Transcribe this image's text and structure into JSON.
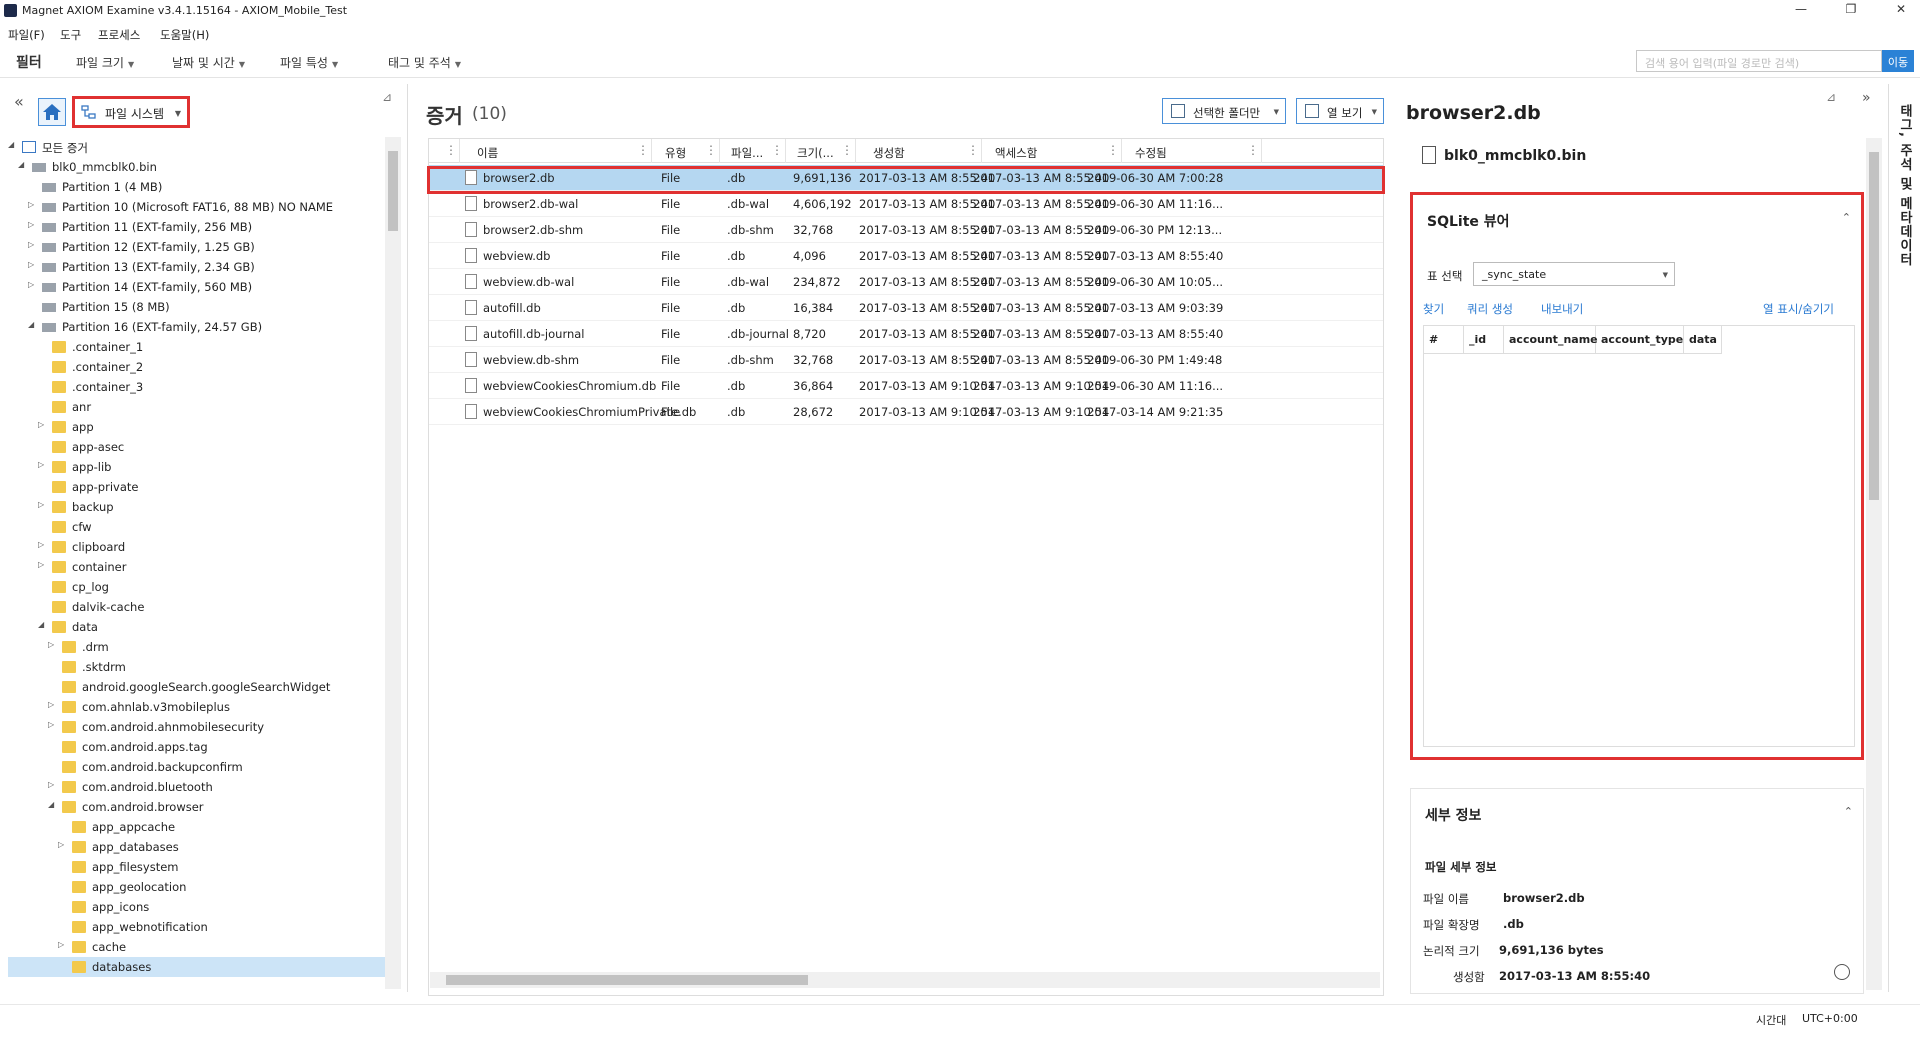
{
  "window": {
    "title": "Magnet AXIOM Examine v3.4.1.15164 - AXIOM_Mobile_Test",
    "minimize": "—",
    "maximize": "❐",
    "close": "✕"
  },
  "menu": [
    "파일(F)",
    "도구",
    "프로세스",
    "도움말(H)"
  ],
  "filterbar": {
    "label": "필터",
    "items": [
      "파일 크기",
      "날짜 및 시간",
      "파일 특성",
      "태그 및 주석"
    ],
    "search_placeholder": "검색 용어 입력(파일 경로만 검색)",
    "search_button": "이동"
  },
  "left": {
    "dropdown_label": "파일 시스템",
    "tree": [
      {
        "label": "모든 증거",
        "level": 0,
        "expand": "◢",
        "icon": "root"
      },
      {
        "label": "blk0_mmcblk0.bin",
        "level": 1,
        "expand": "◢",
        "icon": "drive"
      },
      {
        "label": "Partition 1 (4 MB)",
        "level": 2,
        "expand": "",
        "icon": "drive"
      },
      {
        "label": "Partition 10 (Microsoft FAT16, 88 MB) NO NAME",
        "level": 2,
        "expand": "▷",
        "icon": "drive"
      },
      {
        "label": "Partition 11 (EXT-family, 256 MB)",
        "level": 2,
        "expand": "▷",
        "icon": "drive"
      },
      {
        "label": "Partition 12 (EXT-family, 1.25 GB)",
        "level": 2,
        "expand": "▷",
        "icon": "drive"
      },
      {
        "label": "Partition 13 (EXT-family, 2.34 GB)",
        "level": 2,
        "expand": "▷",
        "icon": "drive"
      },
      {
        "label": "Partition 14 (EXT-family, 560 MB)",
        "level": 2,
        "expand": "▷",
        "icon": "drive"
      },
      {
        "label": "Partition 15 (8 MB)",
        "level": 2,
        "expand": "",
        "icon": "drive"
      },
      {
        "label": "Partition 16 (EXT-family, 24.57 GB)",
        "level": 2,
        "expand": "◢",
        "icon": "drive"
      },
      {
        "label": ".container_1",
        "level": 3,
        "expand": "",
        "icon": "folder"
      },
      {
        "label": ".container_2",
        "level": 3,
        "expand": "",
        "icon": "folder"
      },
      {
        "label": ".container_3",
        "level": 3,
        "expand": "",
        "icon": "folder"
      },
      {
        "label": "anr",
        "level": 3,
        "expand": "",
        "icon": "folder"
      },
      {
        "label": "app",
        "level": 3,
        "expand": "▷",
        "icon": "folder"
      },
      {
        "label": "app-asec",
        "level": 3,
        "expand": "",
        "icon": "folder"
      },
      {
        "label": "app-lib",
        "level": 3,
        "expand": "▷",
        "icon": "folder"
      },
      {
        "label": "app-private",
        "level": 3,
        "expand": "",
        "icon": "folder"
      },
      {
        "label": "backup",
        "level": 3,
        "expand": "▷",
        "icon": "folder"
      },
      {
        "label": "cfw",
        "level": 3,
        "expand": "",
        "icon": "folder"
      },
      {
        "label": "clipboard",
        "level": 3,
        "expand": "▷",
        "icon": "folder"
      },
      {
        "label": "container",
        "level": 3,
        "expand": "▷",
        "icon": "folder"
      },
      {
        "label": "cp_log",
        "level": 3,
        "expand": "",
        "icon": "folder"
      },
      {
        "label": "dalvik-cache",
        "level": 3,
        "expand": "",
        "icon": "folder"
      },
      {
        "label": "data",
        "level": 3,
        "expand": "◢",
        "icon": "folder"
      },
      {
        "label": ".drm",
        "level": 4,
        "expand": "▷",
        "icon": "folder"
      },
      {
        "label": ".sktdrm",
        "level": 4,
        "expand": "",
        "icon": "folder"
      },
      {
        "label": "android.googleSearch.googleSearchWidget",
        "level": 4,
        "expand": "",
        "icon": "folder"
      },
      {
        "label": "com.ahnlab.v3mobileplus",
        "level": 4,
        "expand": "▷",
        "icon": "folder"
      },
      {
        "label": "com.android.ahnmobilesecurity",
        "level": 4,
        "expand": "▷",
        "icon": "folder"
      },
      {
        "label": "com.android.apps.tag",
        "level": 4,
        "expand": "",
        "icon": "folder"
      },
      {
        "label": "com.android.backupconfirm",
        "level": 4,
        "expand": "",
        "icon": "folder"
      },
      {
        "label": "com.android.bluetooth",
        "level": 4,
        "expand": "▷",
        "icon": "folder"
      },
      {
        "label": "com.android.browser",
        "level": 4,
        "expand": "◢",
        "icon": "folder"
      },
      {
        "label": "app_appcache",
        "level": 5,
        "expand": "",
        "icon": "folder"
      },
      {
        "label": "app_databases",
        "level": 5,
        "expand": "▷",
        "icon": "folder"
      },
      {
        "label": "app_filesystem",
        "level": 5,
        "expand": "",
        "icon": "folder"
      },
      {
        "label": "app_geolocation",
        "level": 5,
        "expand": "",
        "icon": "folder"
      },
      {
        "label": "app_icons",
        "level": 5,
        "expand": "",
        "icon": "folder"
      },
      {
        "label": "app_webnotification",
        "level": 5,
        "expand": "",
        "icon": "folder"
      },
      {
        "label": "cache",
        "level": 5,
        "expand": "▷",
        "icon": "folder"
      },
      {
        "label": "databases",
        "level": 5,
        "expand": "",
        "icon": "folder",
        "selected": true
      }
    ]
  },
  "center": {
    "title": "증거",
    "count": "(10)",
    "folder_button": "선택한 폴더만",
    "view_button": "열 보기",
    "columns": [
      "이름",
      "유형",
      "파일...",
      "크기(...",
      "생성함",
      "액세스함",
      "수정됨"
    ],
    "rows": [
      {
        "name": "browser2.db",
        "type": "File",
        "ext": ".db",
        "size": "9,691,136",
        "created": "2017-03-13 AM 8:55:40",
        "accessed": "2017-03-13 AM 8:55:40",
        "modified": "2019-06-30 AM 7:00:28",
        "selected": true
      },
      {
        "name": "browser2.db-wal",
        "type": "File",
        "ext": ".db-wal",
        "size": "4,606,192",
        "created": "2017-03-13 AM 8:55:40",
        "accessed": "2017-03-13 AM 8:55:40",
        "modified": "2019-06-30 AM 11:16..."
      },
      {
        "name": "browser2.db-shm",
        "type": "File",
        "ext": ".db-shm",
        "size": "32,768",
        "created": "2017-03-13 AM 8:55:40",
        "accessed": "2017-03-13 AM 8:55:40",
        "modified": "2019-06-30 PM 12:13..."
      },
      {
        "name": "webview.db",
        "type": "File",
        "ext": ".db",
        "size": "4,096",
        "created": "2017-03-13 AM 8:55:40",
        "accessed": "2017-03-13 AM 8:55:40",
        "modified": "2017-03-13 AM 8:55:40"
      },
      {
        "name": "webview.db-wal",
        "type": "File",
        "ext": ".db-wal",
        "size": "234,872",
        "created": "2017-03-13 AM 8:55:40",
        "accessed": "2017-03-13 AM 8:55:40",
        "modified": "2019-06-30 AM 10:05..."
      },
      {
        "name": "autofill.db",
        "type": "File",
        "ext": ".db",
        "size": "16,384",
        "created": "2017-03-13 AM 8:55:40",
        "accessed": "2017-03-13 AM 8:55:40",
        "modified": "2017-03-13 AM 9:03:39"
      },
      {
        "name": "autofill.db-journal",
        "type": "File",
        "ext": ".db-journal",
        "size": "8,720",
        "created": "2017-03-13 AM 8:55:40",
        "accessed": "2017-03-13 AM 8:55:40",
        "modified": "2017-03-13 AM 8:55:40"
      },
      {
        "name": "webview.db-shm",
        "type": "File",
        "ext": ".db-shm",
        "size": "32,768",
        "created": "2017-03-13 AM 8:55:40",
        "accessed": "2017-03-13 AM 8:55:40",
        "modified": "2019-06-30 PM 1:49:48"
      },
      {
        "name": "webviewCookiesChromium.db",
        "type": "File",
        "ext": ".db",
        "size": "36,864",
        "created": "2017-03-13 AM 9:10:54",
        "accessed": "2017-03-13 AM 9:10:54",
        "modified": "2019-06-30 AM 11:16..."
      },
      {
        "name": "webviewCookiesChromiumPrivate.db",
        "type": "File",
        "ext": ".db",
        "size": "28,672",
        "created": "2017-03-13 AM 9:10:54",
        "accessed": "2017-03-13 AM 9:10:54",
        "modified": "2017-03-14 AM 9:21:35"
      }
    ]
  },
  "right": {
    "title": "browser2.db",
    "file": "blk0_mmcblk0.bin",
    "sqlite": {
      "title": "SQLite 뷰어",
      "table_label": "표 선택",
      "table_value": "_sync_state",
      "links": [
        "찾기",
        "쿼리 생성",
        "내보내기"
      ],
      "toggle_link": "열 표시/숨기기",
      "columns": [
        "#",
        "_id",
        "account_name",
        "account_type",
        "data"
      ]
    },
    "details": {
      "title": "세부 정보",
      "subtitle": "파일 세부 정보",
      "fields": [
        {
          "label": "파일 이름",
          "value": "browser2.db"
        },
        {
          "label": "파일 확장명",
          "value": ".db"
        },
        {
          "label": "논리적 크기",
          "value": "9,691,136 bytes"
        },
        {
          "label": "생성함",
          "value": "2017-03-13 AM 8:55:40"
        }
      ]
    },
    "vertical_tab": "태그, 주석 및 메타데이터"
  },
  "status": {
    "tz_label": "시간대",
    "tz_value": "UTC+0:00"
  },
  "colors": {
    "accent": "#2b82d6",
    "highlight": "#e03131",
    "selection": "#b5d7f1",
    "folder": "#f2c94c"
  }
}
